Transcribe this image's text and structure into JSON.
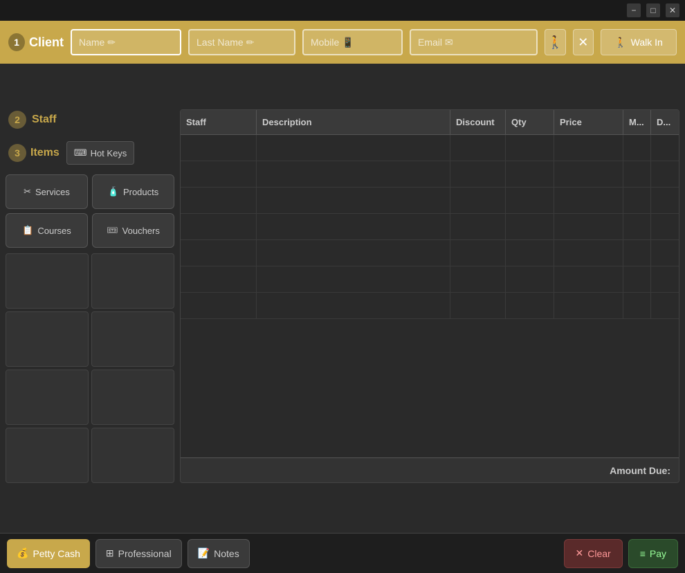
{
  "titlebar": {
    "minimize": "−",
    "maximize": "□",
    "close": "✕"
  },
  "client": {
    "section_num": "1",
    "section_label": "Client",
    "name_placeholder": "Name ✏",
    "lastname_placeholder": "Last Name ✏",
    "mobile_placeholder": "Mobile 📱",
    "email_placeholder": "Email ✉",
    "walkin_label": "Walk In"
  },
  "staff": {
    "section_num": "2",
    "section_label": "Staff"
  },
  "items": {
    "section_num": "3",
    "section_label": "Items",
    "hotkeys_label": "Hot Keys",
    "services_label": "Services",
    "products_label": "Products",
    "courses_label": "Courses",
    "vouchers_label": "Vouchers"
  },
  "table": {
    "columns": [
      "Staff",
      "Description",
      "Discount",
      "Qty",
      "Price",
      "M...",
      "D..."
    ],
    "amount_due_label": "Amount Due:"
  },
  "bottom": {
    "petty_cash_label": "Petty Cash",
    "professional_label": "Professional",
    "notes_label": "Notes",
    "clear_label": "Clear",
    "pay_label": "Pay"
  }
}
